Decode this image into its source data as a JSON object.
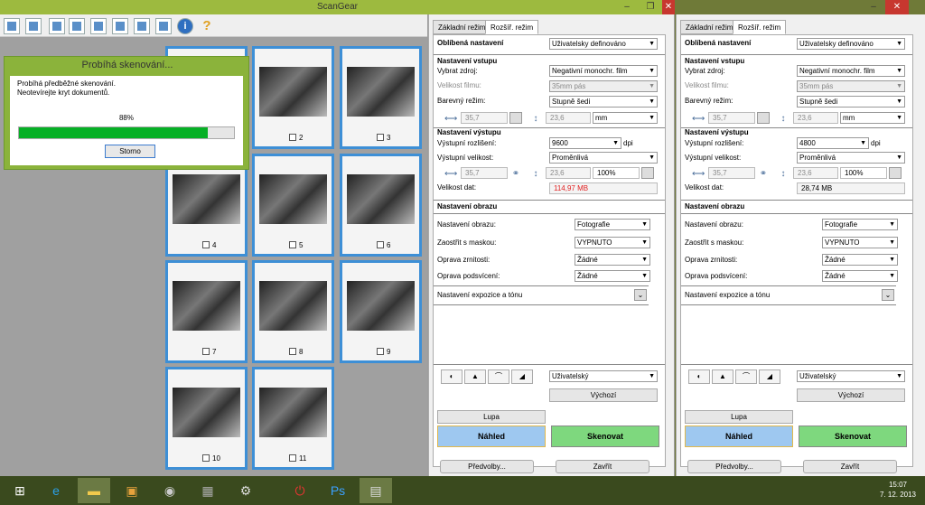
{
  "window": {
    "title": "ScanGear",
    "min_icon": "minimize-icon",
    "max_icon": "maximize-icon",
    "close_icon": "close-icon",
    "min": "–",
    "max": "❐",
    "close": "✕"
  },
  "thumbnails": [
    {
      "num": "2"
    },
    {
      "num": "3"
    },
    {
      "num": "4"
    },
    {
      "num": "5"
    },
    {
      "num": "6"
    },
    {
      "num": "7"
    },
    {
      "num": "8"
    },
    {
      "num": "9"
    },
    {
      "num": "10"
    },
    {
      "num": "11"
    }
  ],
  "dialog": {
    "title": "Probíhá skenování...",
    "line1": "Probíhá předběžné skenování.",
    "line2": "Neotevírejte kryt dokumentů.",
    "percent": "88%",
    "progress": 0.88,
    "cancel": "Storno"
  },
  "panels": [
    {
      "tab_basic": "Základní režim",
      "tab_adv": "Rozšíř. režim",
      "fav_label": "Oblíbená nastavení",
      "fav_value": "Uživatelsky definováno",
      "input_heading": "Nastavení vstupu",
      "source_label": "Vybrat zdroj:",
      "source_value": "Negativní monochr. film",
      "film_label": "Velikost filmu:",
      "film_value": "35mm pás",
      "color_label": "Barevný režim:",
      "color_value": "Stupně šedi",
      "in_w": "35,7",
      "in_h": "23,6",
      "unit": "mm",
      "output_heading": "Nastavení výstupu",
      "res_label": "Výstupní rozlišení:",
      "res_value": "9600",
      "dpi": "dpi",
      "size_label": "Výstupní velikost:",
      "size_value": "Proměnlivá",
      "out_w": "35,7",
      "out_h": "23,6",
      "scale": "100%",
      "data_label": "Velikost dat:",
      "data_value": "114,97 MB",
      "image_heading": "Nastavení obrazu",
      "img_label": "Nastavení obrazu:",
      "img_value": "Fotografie",
      "sharp_label": "Zaostřit s maskou:",
      "sharp_value": "VYPNUTO",
      "grain_label": "Oprava zrnitosti:",
      "grain_value": "Žádné",
      "back_label": "Oprava podsvícení:",
      "back_value": "Žádné",
      "expo_label": "Nastavení expozice a tónu",
      "tone_value": "Uživatelský",
      "default": "Výchozí",
      "zoom": "Lupa",
      "preview": "Náhled",
      "scan": "Skenovat",
      "prefs": "Předvolby...",
      "close": "Zavřít"
    },
    {
      "tab_basic": "Základní režim",
      "tab_adv": "Rozšíř. režim",
      "fav_label": "Oblíbená nastavení",
      "fav_value": "Uživatelsky definováno",
      "input_heading": "Nastavení vstupu",
      "source_label": "Vybrat zdroj:",
      "source_value": "Negativní monochr. film",
      "film_label": "Velikost filmu:",
      "film_value": "35mm pás",
      "color_label": "Barevný režim:",
      "color_value": "Stupně šedi",
      "in_w": "35,7",
      "in_h": "23,6",
      "unit": "mm",
      "output_heading": "Nastavení výstupu",
      "res_label": "Výstupní rozlišení:",
      "res_value": "4800",
      "dpi": "dpi",
      "size_label": "Výstupní velikost:",
      "size_value": "Proměnlivá",
      "out_w": "35,7",
      "out_h": "23,6",
      "scale": "100%",
      "data_label": "Velikost dat:",
      "data_value": "28,74 MB",
      "image_heading": "Nastavení obrazu",
      "img_label": "Nastavení obrazu:",
      "img_value": "Fotografie",
      "sharp_label": "Zaostřit s maskou:",
      "sharp_value": "VYPNUTO",
      "grain_label": "Oprava zrnitosti:",
      "grain_value": "Žádné",
      "back_label": "Oprava podsvícení:",
      "back_value": "Žádné",
      "expo_label": "Nastavení expozice a tónu",
      "tone_value": "Uživatelský",
      "default": "Výchozí",
      "zoom": "Lupa",
      "preview": "Náhled",
      "scan": "Skenovat",
      "prefs": "Předvolby...",
      "close": "Zavřít"
    }
  ],
  "taskbar": {
    "time": "15:07",
    "date": "7. 12. 2013"
  },
  "colors": {
    "preview": "#9ec8f0",
    "scan": "#7ed87e",
    "datasize_warn": "#e02020"
  }
}
